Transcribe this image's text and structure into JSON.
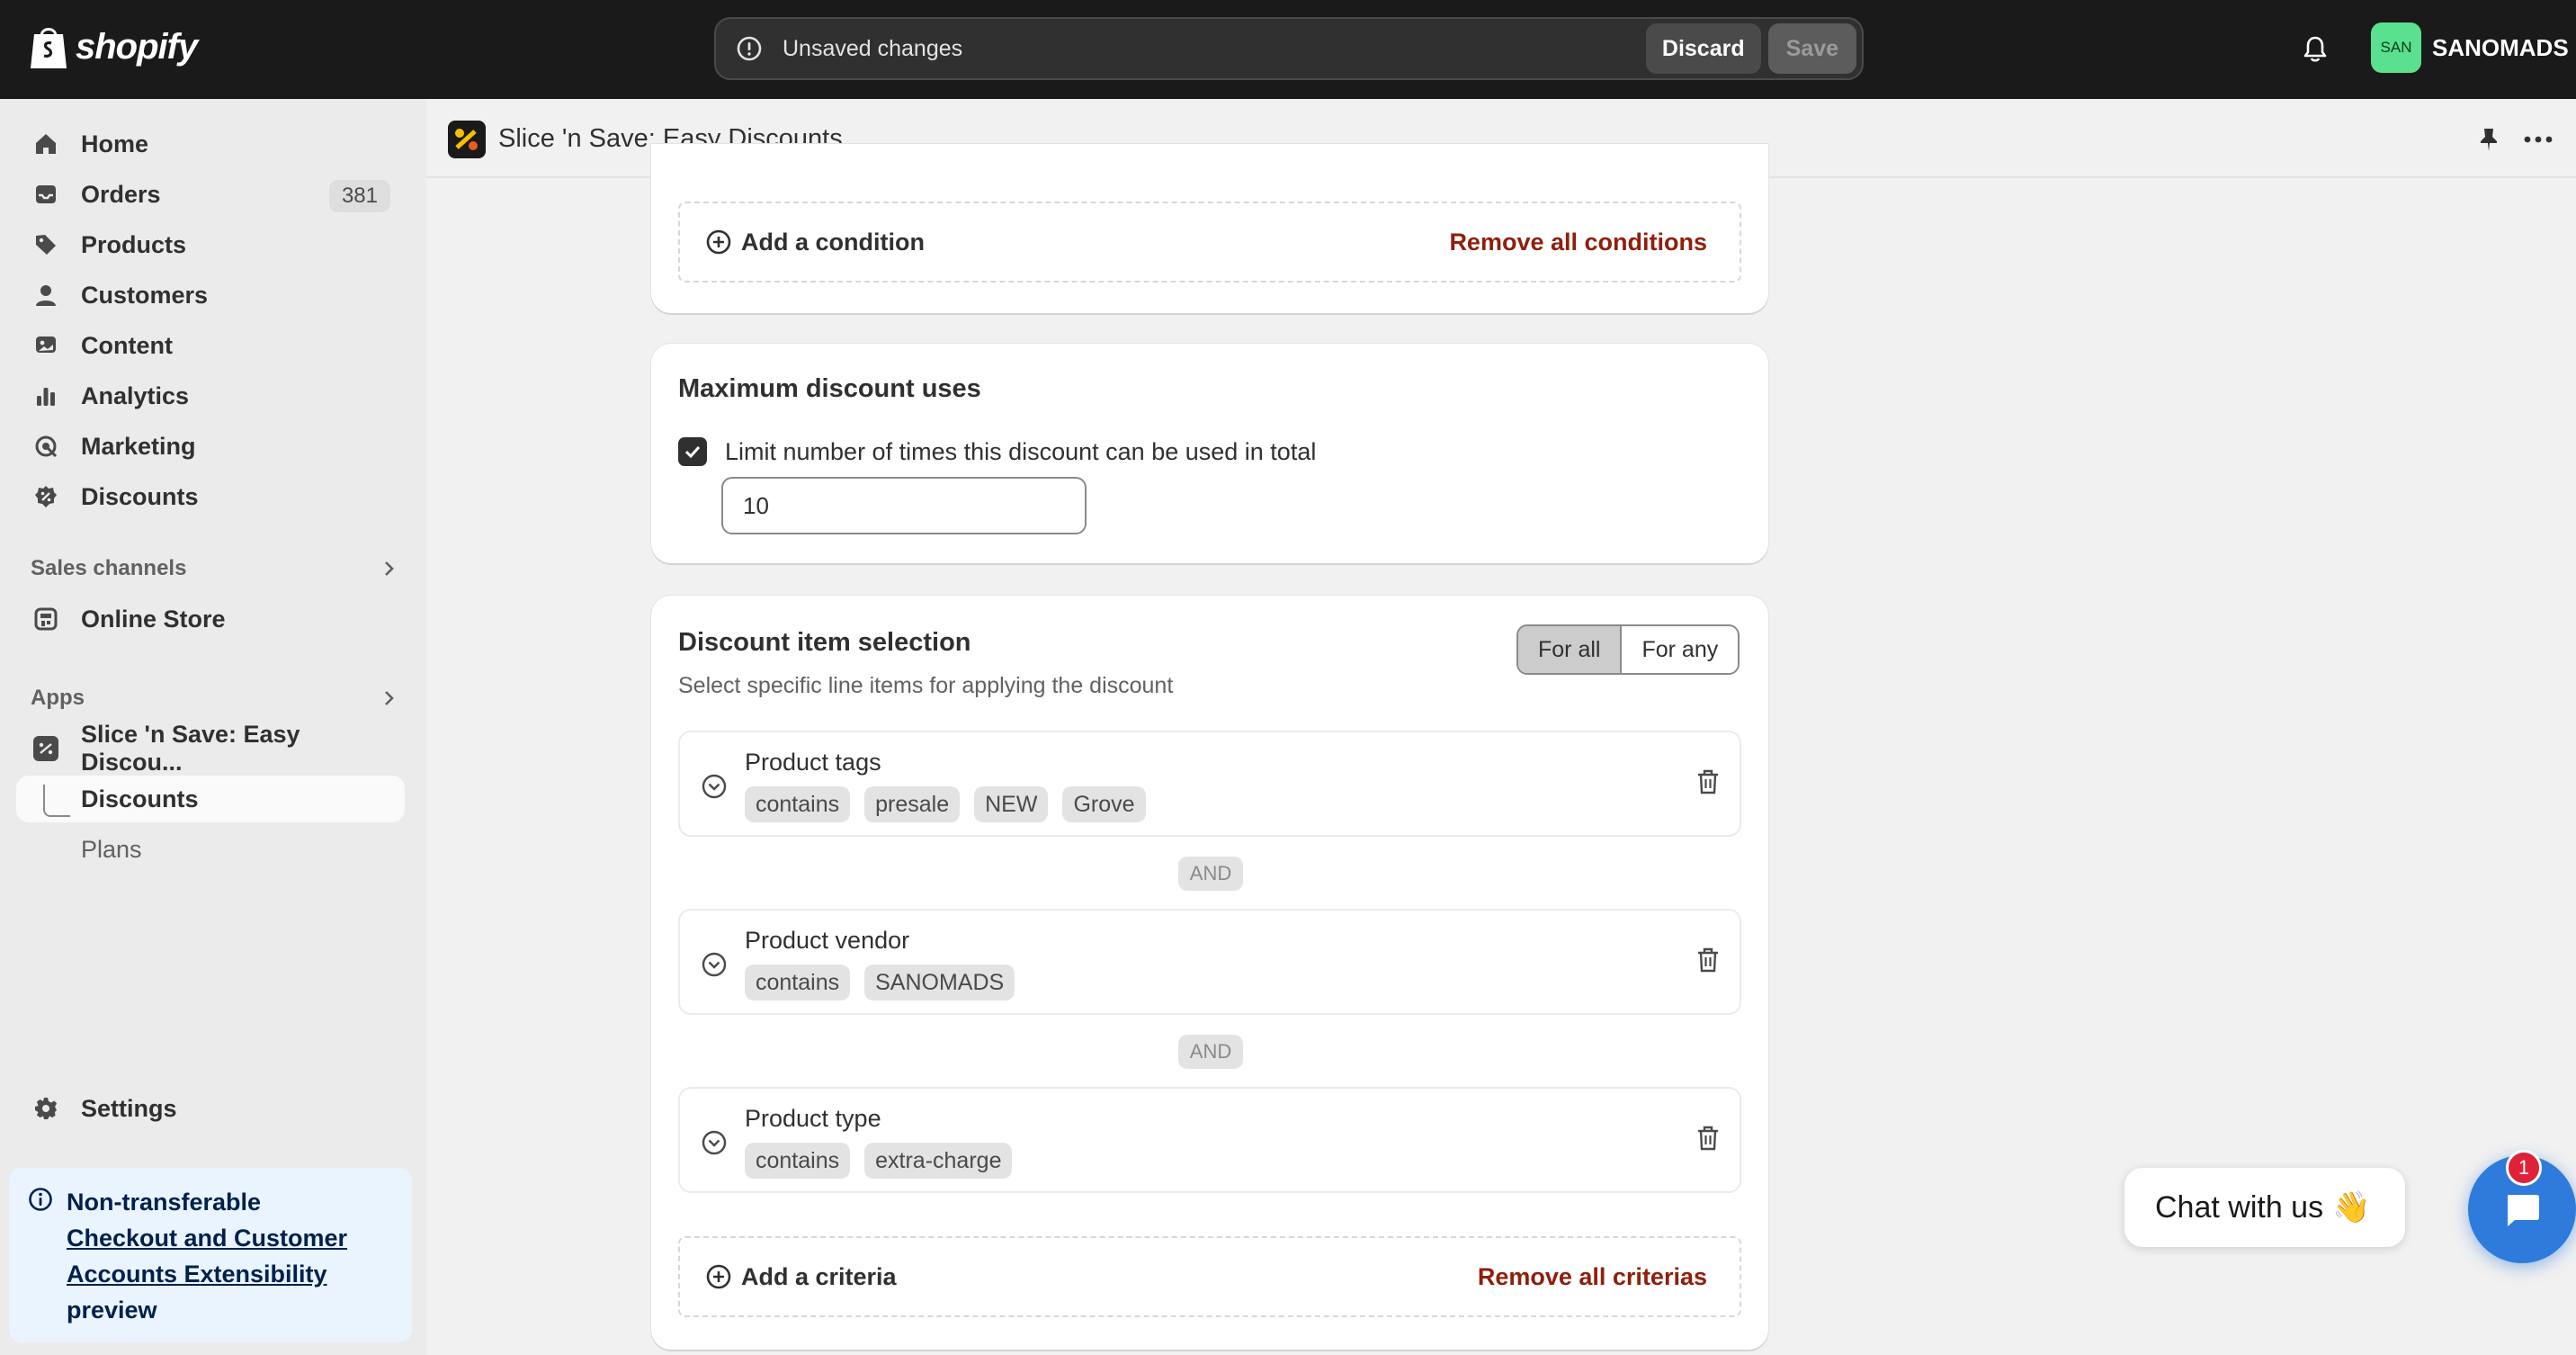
{
  "topbar": {
    "logo_text": "shopify",
    "unsaved_text": "Unsaved changes",
    "discard_label": "Discard",
    "save_label": "Save",
    "avatar_initials": "SAN",
    "store_name": "SANOMADS"
  },
  "sidebar": {
    "items": [
      {
        "label": "Home",
        "icon": "home-icon"
      },
      {
        "label": "Orders",
        "icon": "inbox-icon",
        "badge": "381"
      },
      {
        "label": "Products",
        "icon": "tag-icon"
      },
      {
        "label": "Customers",
        "icon": "person-icon"
      },
      {
        "label": "Content",
        "icon": "image-icon"
      },
      {
        "label": "Analytics",
        "icon": "bar-chart-icon"
      },
      {
        "label": "Marketing",
        "icon": "target-icon"
      },
      {
        "label": "Discounts",
        "icon": "discount-icon"
      }
    ],
    "sales_channels_label": "Sales channels",
    "online_store_label": "Online Store",
    "apps_label": "Apps",
    "app_name": "Slice 'n Save: Easy Discou...",
    "app_sub_discounts": "Discounts",
    "app_sub_plans": "Plans",
    "settings_label": "Settings",
    "notice": {
      "line1": "Non-transferable",
      "link": "Checkout and Customer Accounts Extensibility",
      "line3": "preview"
    }
  },
  "app_header": {
    "title": "Slice 'n Save: Easy Discounts"
  },
  "conditions_card": {
    "add_label": "Add a condition",
    "remove_label": "Remove all conditions"
  },
  "max_uses_card": {
    "title": "Maximum discount uses",
    "checkbox_label": "Limit number of times this discount can be used in total",
    "checked": true,
    "value": "10"
  },
  "selection_card": {
    "title": "Discount item selection",
    "subtitle": "Select specific line items for applying the discount",
    "segment_for_all": "For all",
    "segment_for_any": "For any",
    "and_label": "AND",
    "criteria": [
      {
        "name": "Product tags",
        "tags": [
          "contains",
          "presale",
          "NEW",
          "Grove"
        ]
      },
      {
        "name": "Product vendor",
        "tags": [
          "contains",
          "SANOMADS"
        ]
      },
      {
        "name": "Product type",
        "tags": [
          "contains",
          "extra-charge"
        ]
      }
    ],
    "add_label": "Add a criteria",
    "remove_label": "Remove all criterias"
  },
  "chat": {
    "text": "Chat with us",
    "emoji": "👋",
    "badge": "1"
  },
  "colors": {
    "topbar_bg": "#1a1a1a",
    "critical_link": "#8e1f0b",
    "chat_blue": "#2f7bdc",
    "avatar_green": "#5be08f"
  }
}
